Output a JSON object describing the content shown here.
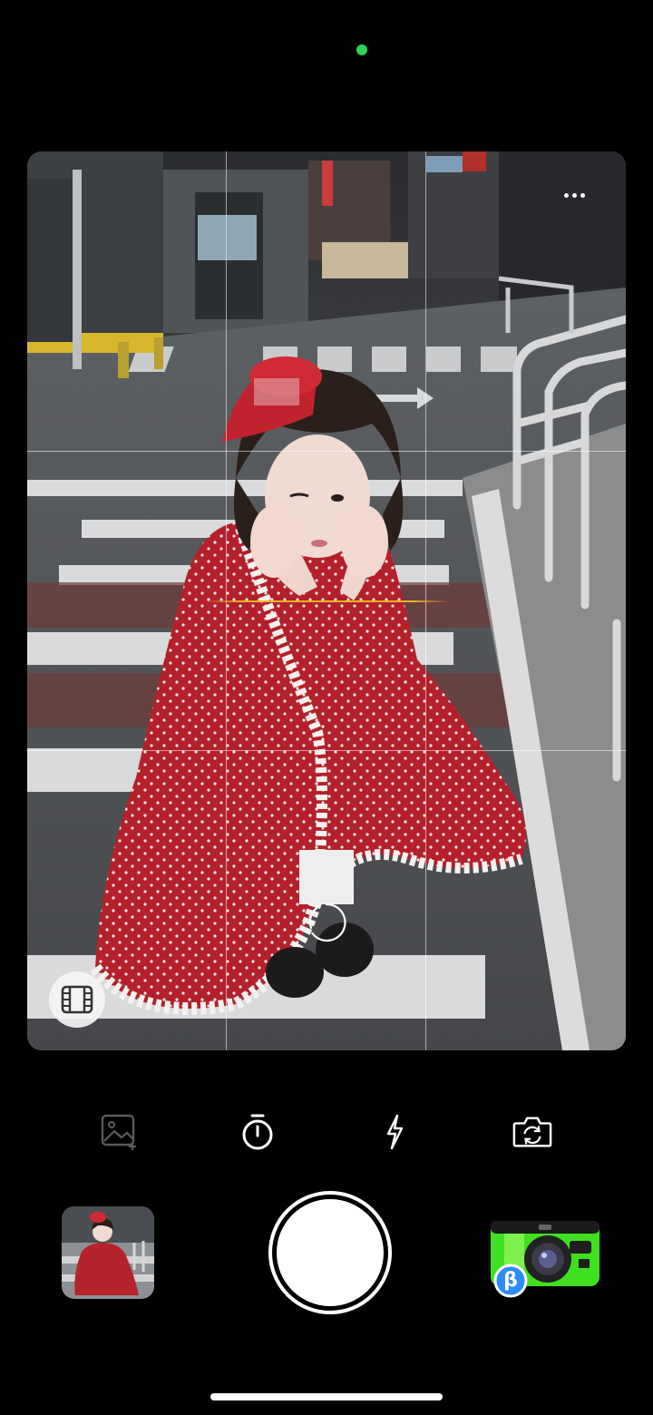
{
  "status": {
    "privacy_indicator_color": "#2fd158"
  },
  "viewfinder": {
    "grid": "3x3",
    "level_indicator_color": "#f2b322",
    "more_icon": "more-horizontal-icon",
    "focus_icon": "focus-ring-icon",
    "video_mode_icon": "film-icon"
  },
  "toolbar": {
    "icons": [
      "add-image-icon",
      "timer-icon",
      "flash-icon",
      "switch-camera-icon"
    ]
  },
  "bottom": {
    "gallery_thumbnail": "recent-photo",
    "shutter": "shutter-button",
    "camera_style_badge": "β"
  }
}
